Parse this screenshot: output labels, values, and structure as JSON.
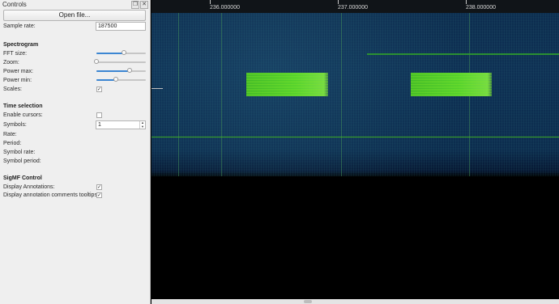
{
  "dock": {
    "title": "Controls",
    "float_icon": "❐",
    "close_icon": "✕",
    "open_file_label": "Open file...",
    "sample_rate_label": "Sample rate:",
    "sample_rate_value": "187500"
  },
  "spectrogram": {
    "heading": "Spectrogram",
    "fft_size_label": "FFT size:",
    "fft_size_level": 0.55,
    "zoom_label": "Zoom:",
    "zoom_level": 0.0,
    "power_max_label": "Power max:",
    "power_max_level": 0.67,
    "power_min_label": "Power min:",
    "power_min_level": 0.4,
    "scales_label": "Scales:",
    "scales_checked": true
  },
  "time_selection": {
    "heading": "Time selection",
    "enable_cursors_label": "Enable cursors:",
    "enable_cursors_checked": false,
    "symbols_label": "Symbols:",
    "symbols_value": "1",
    "rate_label": "Rate:",
    "period_label": "Period:",
    "symbol_rate_label": "Symbol rate:",
    "symbol_period_label": "Symbol period:"
  },
  "sigmf": {
    "heading": "SigMF Control",
    "display_annotations_label": "Display Annotations:",
    "display_annotations_checked": true,
    "display_tooltips_label": "Display annotation comments tooltips:",
    "display_tooltips_checked": true
  },
  "plot": {
    "time_ticks": [
      "236.000000",
      "237.000000",
      "238.000000"
    ],
    "colors": {
      "noise": "#0d2e52",
      "signal": "#4fcf2f",
      "background": "#000000"
    }
  }
}
